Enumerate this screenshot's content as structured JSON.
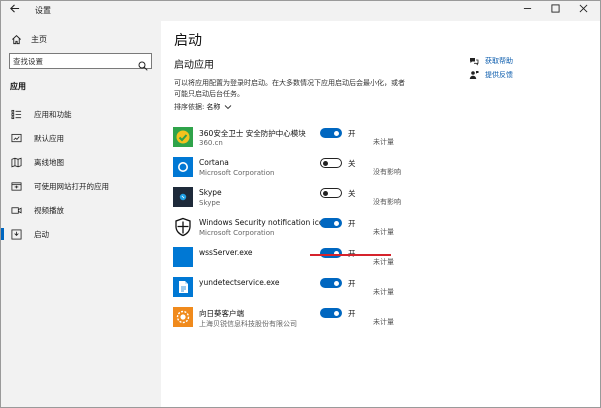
{
  "window": {
    "title": "设置",
    "back_icon": "arrow-left-icon",
    "controls": [
      "minimize-icon",
      "maximize-icon",
      "close-icon"
    ]
  },
  "sidebar": {
    "home_label": "主页",
    "search_placeholder": "查找设置",
    "section_title": "应用",
    "items": [
      {
        "label": "应用和功能",
        "icon": "apps-list-icon"
      },
      {
        "label": "默认应用",
        "icon": "default-apps-icon"
      },
      {
        "label": "离线地图",
        "icon": "map-icon"
      },
      {
        "label": "可使用网站打开的应用",
        "icon": "open-with-icon"
      },
      {
        "label": "视频播放",
        "icon": "video-icon"
      },
      {
        "label": "启动",
        "icon": "startup-icon",
        "active": true
      }
    ]
  },
  "main": {
    "page_title": "启动",
    "section_title": "启动应用",
    "description": "可以将应用配置为登录时启动。在大多数情况下应用启动后会最小化，或者可能只启动后台任务。",
    "sort_label": "排序依据:",
    "sort_value": "名称",
    "help": [
      {
        "label": "获取帮助",
        "icon": "help-chat-icon"
      },
      {
        "label": "提供反馈",
        "icon": "feedback-icon"
      }
    ],
    "apps": [
      {
        "name": "360安全卫士 安全防护中心模块",
        "publisher": "360.cn",
        "on": true,
        "toggle_label": "开",
        "impact": "未计量",
        "icon": "360-shield-icon"
      },
      {
        "name": "Cortana",
        "publisher": "Microsoft Corporation",
        "on": false,
        "toggle_label": "关",
        "impact": "没有影响",
        "icon": "cortana-icon"
      },
      {
        "name": "Skype",
        "publisher": "Skype",
        "on": false,
        "toggle_label": "关",
        "impact": "没有影响",
        "icon": "skype-icon"
      },
      {
        "name": "Windows Security notification icon",
        "publisher": "Microsoft Corporation",
        "on": true,
        "toggle_label": "开",
        "impact": "未计量",
        "icon": "windows-security-icon"
      },
      {
        "name": "wssServer.exe",
        "publisher": "",
        "on": true,
        "toggle_label": "开",
        "impact": "未计量",
        "icon": "blank-app-icon"
      },
      {
        "name": "yundetectservice.exe",
        "publisher": "",
        "on": true,
        "toggle_label": "开",
        "impact": "未计量",
        "icon": "document-app-icon"
      },
      {
        "name": "向日葵客户端",
        "publisher": "上海贝锐信息科技股份有限公司",
        "on": true,
        "toggle_label": "开",
        "impact": "未计量",
        "icon": "sunflower-icon"
      }
    ]
  },
  "colors": {
    "accent": "#0067c0",
    "annotation_red": "#d6232c",
    "sidebar_bg": "#f2f2f2"
  }
}
